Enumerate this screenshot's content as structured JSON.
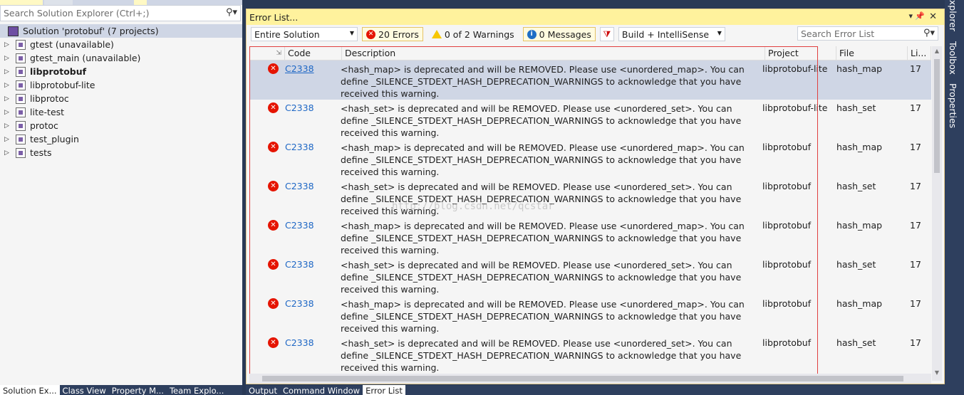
{
  "solution_explorer": {
    "search_placeholder": "Search Solution Explorer (Ctrl+;)",
    "solution_label": "Solution 'protobuf' (7 projects)",
    "items": [
      {
        "label": "gtest (unavailable)",
        "bold": false,
        "unavailable": true
      },
      {
        "label": "gtest_main (unavailable)",
        "bold": false,
        "unavailable": true
      },
      {
        "label": "libprotobuf",
        "bold": true,
        "unavailable": false
      },
      {
        "label": "libprotobuf-lite",
        "bold": false,
        "unavailable": false
      },
      {
        "label": "libprotoc",
        "bold": false,
        "unavailable": false
      },
      {
        "label": "lite-test",
        "bold": false,
        "unavailable": false
      },
      {
        "label": "protoc",
        "bold": false,
        "unavailable": false
      },
      {
        "label": "test_plugin",
        "bold": false,
        "unavailable": false
      },
      {
        "label": "tests",
        "bold": false,
        "unavailable": false
      }
    ],
    "bottom_tabs": [
      "Solution Ex...",
      "Class View",
      "Property M...",
      "Team Explo..."
    ]
  },
  "error_list": {
    "title": "Error List...",
    "scope": "Entire Solution",
    "errors_label": "20 Errors",
    "warnings_label": "0 of 2 Warnings",
    "messages_label": "0 Messages",
    "build_filter": "Build + IntelliSense",
    "search_placeholder": "Search Error List",
    "columns": {
      "code": "Code",
      "description": "Description",
      "project": "Project",
      "file": "File",
      "line": "Li..."
    },
    "rows": [
      {
        "code": "C2338",
        "description": "<hash_map> is deprecated and will be REMOVED. Please use <unordered_map>. You can define _SILENCE_STDEXT_HASH_DEPRECATION_WARNINGS to acknowledge that you have received this warning.",
        "project": "libprotobuf-lite",
        "file": "hash_map",
        "line": "17"
      },
      {
        "code": "C2338",
        "description": "<hash_set> is deprecated and will be REMOVED. Please use <unordered_set>. You can define _SILENCE_STDEXT_HASH_DEPRECATION_WARNINGS to acknowledge that you have received this warning.",
        "project": "libprotobuf-lite",
        "file": "hash_set",
        "line": "17"
      },
      {
        "code": "C2338",
        "description": "<hash_map> is deprecated and will be REMOVED. Please use <unordered_map>. You can define _SILENCE_STDEXT_HASH_DEPRECATION_WARNINGS to acknowledge that you have received this warning.",
        "project": "libprotobuf",
        "file": "hash_map",
        "line": "17"
      },
      {
        "code": "C2338",
        "description": "<hash_set> is deprecated and will be REMOVED. Please use <unordered_set>. You can define _SILENCE_STDEXT_HASH_DEPRECATION_WARNINGS to acknowledge that you have received this warning.",
        "project": "libprotobuf",
        "file": "hash_set",
        "line": "17"
      },
      {
        "code": "C2338",
        "description": "<hash_map> is deprecated and will be REMOVED. Please use <unordered_map>. You can define _SILENCE_STDEXT_HASH_DEPRECATION_WARNINGS to acknowledge that you have received this warning.",
        "project": "libprotobuf",
        "file": "hash_map",
        "line": "17"
      },
      {
        "code": "C2338",
        "description": "<hash_set> is deprecated and will be REMOVED. Please use <unordered_set>. You can define _SILENCE_STDEXT_HASH_DEPRECATION_WARNINGS to acknowledge that you have received this warning.",
        "project": "libprotobuf",
        "file": "hash_set",
        "line": "17"
      },
      {
        "code": "C2338",
        "description": "<hash_map> is deprecated and will be REMOVED. Please use <unordered_map>. You can define _SILENCE_STDEXT_HASH_DEPRECATION_WARNINGS to acknowledge that you have received this warning.",
        "project": "libprotobuf",
        "file": "hash_map",
        "line": "17"
      },
      {
        "code": "C2338",
        "description": "<hash_set> is deprecated and will be REMOVED. Please use <unordered_set>. You can define _SILENCE_STDEXT_HASH_DEPRECATION_WARNINGS to acknowledge that you have received this warning.",
        "project": "libprotobuf",
        "file": "hash_set",
        "line": "17"
      }
    ],
    "watermark": "http://blog.csdn.net/qcstar",
    "bottom_tabs": [
      "Output",
      "Command Window",
      "Error List"
    ]
  },
  "right_strip": {
    "tabs": [
      "Explorer",
      "Toolbox",
      "Properties"
    ]
  },
  "colors": {
    "accent_panel_title": "#fff29d",
    "error_red": "#e51400",
    "selection": "#cfd6e5",
    "chrome_dark": "#2e3f5e",
    "link_blue": "#1e67c5"
  }
}
